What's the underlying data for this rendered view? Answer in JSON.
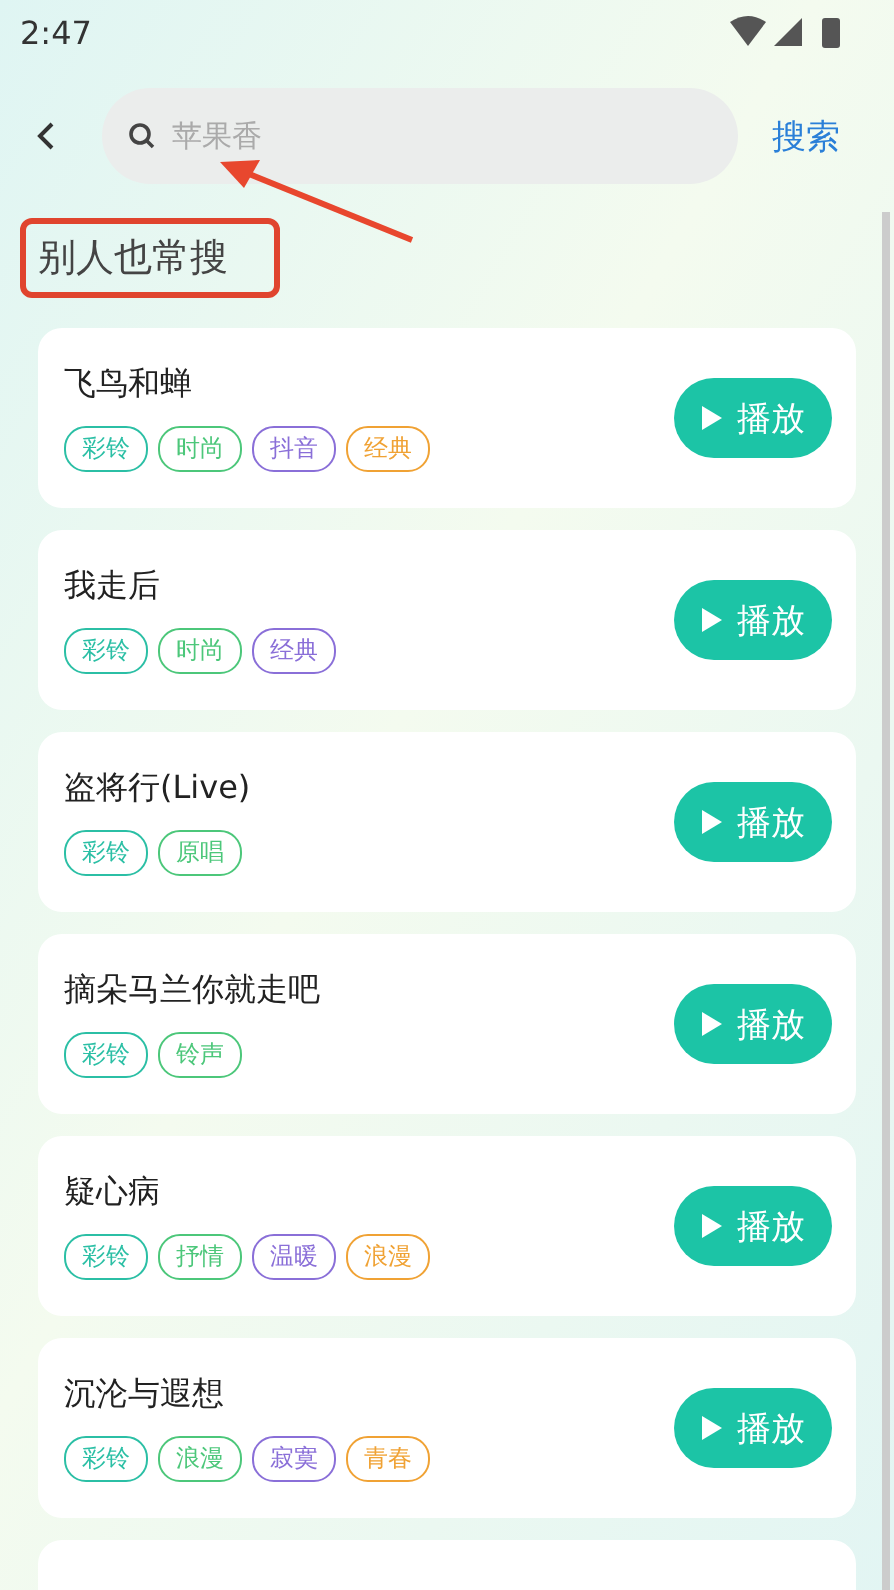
{
  "status_bar": {
    "time": "2:47"
  },
  "search": {
    "placeholder": "苹果香",
    "button": "搜索"
  },
  "section_title": "别人也常搜",
  "songs": [
    {
      "title": "飞鸟和蝉",
      "button": "播放",
      "tags": [
        {
          "label": "彩铃",
          "color": "#2bbfa5"
        },
        {
          "label": "时尚",
          "color": "#4cc77a"
        },
        {
          "label": "抖音",
          "color": "#8a6fd8"
        },
        {
          "label": "经典",
          "color": "#f0a234"
        }
      ]
    },
    {
      "title": "我走后",
      "button": "播放",
      "tags": [
        {
          "label": "彩铃",
          "color": "#2bbfa5"
        },
        {
          "label": "时尚",
          "color": "#4cc77a"
        },
        {
          "label": "经典",
          "color": "#8a6fd8"
        }
      ]
    },
    {
      "title": "盗将行(Live)",
      "button": "播放",
      "tags": [
        {
          "label": "彩铃",
          "color": "#2bbfa5"
        },
        {
          "label": "原唱",
          "color": "#4cc77a"
        }
      ]
    },
    {
      "title": "摘朵马兰你就走吧",
      "button": "播放",
      "tags": [
        {
          "label": "彩铃",
          "color": "#2bbfa5"
        },
        {
          "label": "铃声",
          "color": "#4cc77a"
        }
      ]
    },
    {
      "title": "疑心病",
      "button": "播放",
      "tags": [
        {
          "label": "彩铃",
          "color": "#2bbfa5"
        },
        {
          "label": "抒情",
          "color": "#4cc77a"
        },
        {
          "label": "温暖",
          "color": "#8a6fd8"
        },
        {
          "label": "浪漫",
          "color": "#f0a234"
        }
      ]
    },
    {
      "title": "沉沦与遐想",
      "button": "播放",
      "tags": [
        {
          "label": "彩铃",
          "color": "#2bbfa5"
        },
        {
          "label": "浪漫",
          "color": "#4cc77a"
        },
        {
          "label": "寂寞",
          "color": "#8a6fd8"
        },
        {
          "label": "青春",
          "color": "#f0a234"
        }
      ]
    }
  ]
}
